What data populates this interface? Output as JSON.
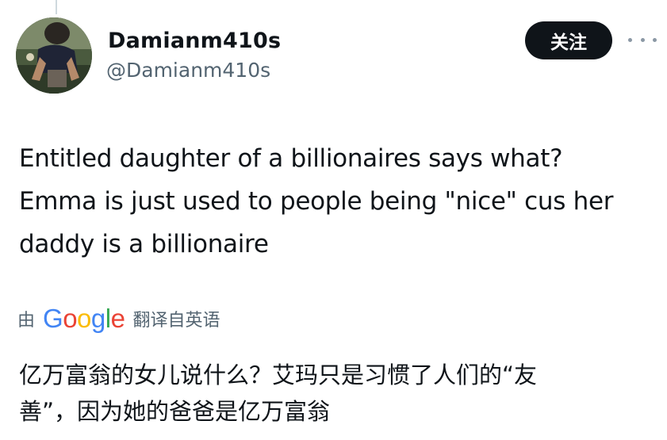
{
  "author": {
    "display_name": "Damianm410s",
    "handle": "@Damianm410s",
    "avatar_icon": "profile-photo"
  },
  "actions": {
    "follow_label": "关注",
    "more_icon": "more-horizontal-icon"
  },
  "tweet": {
    "lines": [
      "Entitled daughter of a billionaires says what?",
      "Emma is just used to people being \"nice\" cus her",
      "daddy is a billionaire"
    ]
  },
  "translation": {
    "prefix": "由",
    "provider": "Google",
    "suffix": "翻译自英语",
    "lines": [
      "亿万富翁的女儿说什么？艾玛只是习惯了人们的“友",
      "善”，因为她的爸爸是亿万富翁"
    ]
  },
  "colors": {
    "text_primary": "#0f1419",
    "text_secondary": "#536471",
    "follow_bg": "#0f1419",
    "google_blue": "#4285f4",
    "google_red": "#ea4335",
    "google_yellow": "#fbbc05",
    "google_green": "#34a853"
  }
}
